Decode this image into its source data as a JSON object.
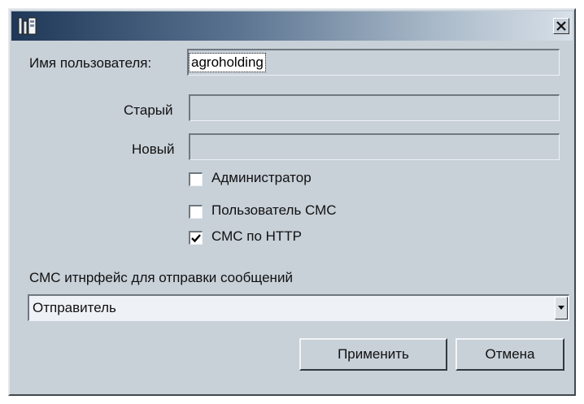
{
  "window": {
    "title": ""
  },
  "icons": {
    "app": "app-window-icon",
    "close": "close-icon",
    "check": "checkmark-icon",
    "dropdown": "chevron-down-icon"
  },
  "form": {
    "username_label": "Имя пользователя:",
    "username_value": "agroholding",
    "old_label": "Старый",
    "old_value": "",
    "new_label": "Новый",
    "new_value": "",
    "checkboxes": [
      {
        "label": "Администратор",
        "checked": false
      },
      {
        "label": "Пользователь СМС",
        "checked": false
      },
      {
        "label": "СМС по HTTP",
        "checked": true
      }
    ],
    "sms_interface_label": "СМС итнрфейс для отправки сообщений",
    "sms_interface_selected": "Отправитель"
  },
  "buttons": {
    "apply": "Применить",
    "cancel": "Отмена"
  },
  "colors": {
    "dialog_bg": "#c8d0d8",
    "title_start": "#1f3858",
    "title_end": "#d8e0e8"
  }
}
